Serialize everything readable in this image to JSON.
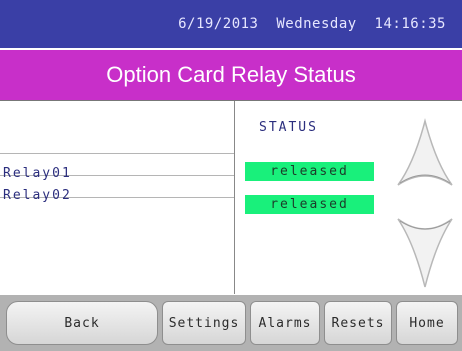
{
  "header": {
    "datetime": "6/19/2013  Wednesday  14:16:35",
    "title": "Option Card Relay Status"
  },
  "table": {
    "status_header": "STATUS",
    "rows": [
      {
        "name": "Relay01",
        "status": "released"
      },
      {
        "name": "Relay02",
        "status": "released"
      }
    ]
  },
  "nav": {
    "up_icon": "chevron-up-icon",
    "down_icon": "chevron-down-icon"
  },
  "buttons": {
    "back": "Back",
    "settings": "Settings",
    "alarms": "Alarms",
    "resets": "Resets",
    "home": "Home"
  },
  "colors": {
    "top_bar": "#3a3fa6",
    "title_bar": "#c82fc9",
    "status_released": "#19f07b",
    "label_text": "#2b2e7e"
  }
}
